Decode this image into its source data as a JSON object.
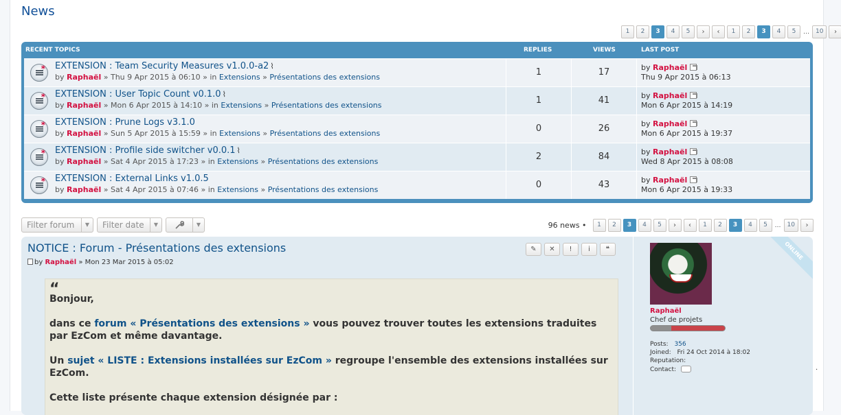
{
  "page": {
    "title": "News"
  },
  "pagination": {
    "pages": [
      "1",
      "2",
      "3",
      "4",
      "5"
    ],
    "start": "1",
    "prev_pages": [
      "1",
      "2"
    ],
    "current": "3",
    "next_pages": [
      "4",
      "5"
    ],
    "ellipsis": "…",
    "last": "10",
    "prev_arrow": "‹",
    "next_arrow": "›",
    "news_count": "96 news •"
  },
  "recent_topics": {
    "header": {
      "title": "RECENT TOPICS",
      "replies": "REPLIES",
      "views": "VIEWS",
      "last_post": "LAST POST"
    },
    "rows": [
      {
        "title": "EXTENSION : Team Security Measures v1.0.0-a2",
        "attachment": true,
        "by": "by",
        "author": "Raphaël",
        "date": "» Thu 9 Apr 2015 à 06:10 » in",
        "forum": "Extensions",
        "sep": "»",
        "subforum": "Présentations des extensions",
        "replies": "1",
        "views": "17",
        "last_by": "by",
        "last_author": "Raphaël",
        "last_date": "Thu 9 Apr 2015 à 06:13"
      },
      {
        "title": "EXTENSION : User Topic Count v0.1.0",
        "attachment": true,
        "by": "by",
        "author": "Raphaël",
        "date": "» Mon 6 Apr 2015 à 14:10 » in",
        "forum": "Extensions",
        "sep": "»",
        "subforum": "Présentations des extensions",
        "replies": "1",
        "views": "41",
        "last_by": "by",
        "last_author": "Raphaël",
        "last_date": "Mon 6 Apr 2015 à 14:19"
      },
      {
        "title": "EXTENSION : Prune Logs v3.1.0",
        "attachment": false,
        "by": "by",
        "author": "Raphaël",
        "date": "» Sun 5 Apr 2015 à 15:59 » in",
        "forum": "Extensions",
        "sep": "»",
        "subforum": "Présentations des extensions",
        "replies": "0",
        "views": "26",
        "last_by": "by",
        "last_author": "Raphaël",
        "last_date": "Mon 6 Apr 2015 à 19:37"
      },
      {
        "title": "EXTENSION : Profile side switcher v0.0.1",
        "attachment": true,
        "by": "by",
        "author": "Raphaël",
        "date": "» Sat 4 Apr 2015 à 17:23 » in",
        "forum": "Extensions",
        "sep": "»",
        "subforum": "Présentations des extensions",
        "replies": "2",
        "views": "84",
        "last_by": "by",
        "last_author": "Raphaël",
        "last_date": "Wed 8 Apr 2015 à 08:08"
      },
      {
        "title": "EXTENSION : External Links v1.0.5",
        "attachment": false,
        "by": "by",
        "author": "Raphaël",
        "date": "» Sat 4 Apr 2015 à 07:46 » in",
        "forum": "Extensions",
        "sep": "»",
        "subforum": "Présentations des extensions",
        "replies": "0",
        "views": "43",
        "last_by": "by",
        "last_author": "Raphaël",
        "last_date": "Mon 6 Apr 2015 à 19:33"
      }
    ]
  },
  "toolbar": {
    "filter_forum": "Filter forum",
    "filter_date": "Filter date",
    "tools_icon": "wrench-icon"
  },
  "post": {
    "title": "NOTICE : Forum - Présentations des extensions",
    "by": "by",
    "author": "Raphaël",
    "date": "» Mon 23 Mar 2015 à 05:02",
    "buttons": [
      "✎",
      "✕",
      "!",
      "i",
      "❝"
    ],
    "quote_mark": "“",
    "p1": "Bonjour,",
    "p2_a": "dans ce ",
    "p2_link": "forum « Présentations des extensions »",
    "p2_b": " vous pouvez trouver toutes les extensions traduites par EzCom et même davantage.",
    "p3_a": "Un ",
    "p3_link": "sujet « LISTE : Extensions installées sur EzCom »",
    "p3_b": " regroupe l'ensemble des extensions installées sur EzCom.",
    "p4": "Cette liste présente chaque extension désignée par :"
  },
  "profile": {
    "online": "ONLINE",
    "name": "Raphaël",
    "rank": "Chef de projets",
    "posts_label": "Posts:",
    "posts": "356",
    "joined_label": "Joined:",
    "joined": "Fri 24 Oct 2014 à 18:02",
    "reputation_label": "Reputation:",
    "contact_label": "Contact:"
  },
  "misc": {
    "dot": "."
  }
}
